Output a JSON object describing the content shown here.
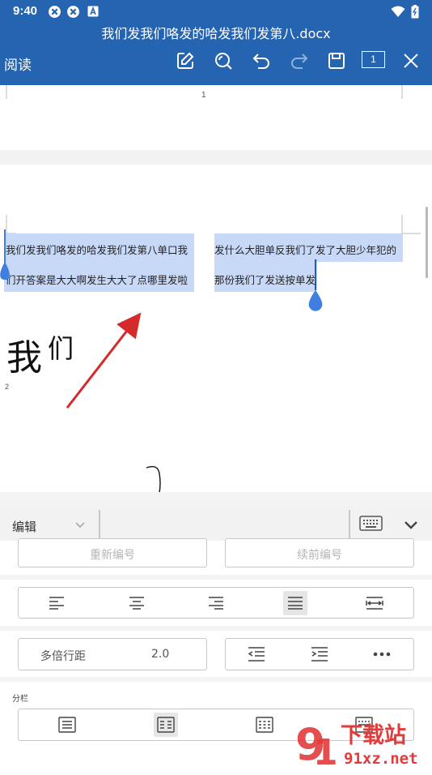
{
  "status_bar": {
    "time": "9:40"
  },
  "title_bar": {
    "document_title": "我们发我们咯发的哈发我们发第八.docx",
    "mode_label": "阅读",
    "page_badge": "1"
  },
  "toolbar_icons": [
    "edit-icon",
    "search-icon",
    "undo-icon",
    "redo-icon",
    "save-icon",
    "page-count-icon",
    "close-icon"
  ],
  "document": {
    "page1_number": "1",
    "page2_number": "2",
    "col1_line1": "我们发我们咯发的哈发我们发第八单口我",
    "col1_line2": "们开答案是大大啊发生大大了点哪里发啦",
    "col2_line1": "发什么大胆单反我们了发了大胆少年犯的",
    "col2_line2": "那份我们了发送按单发",
    "big_text_1": "我",
    "big_text_2": "们"
  },
  "panel": {
    "mode_select": "编辑",
    "renumber_label": "重新编号",
    "continue_number_label": "续前编号",
    "line_spacing_label": "多倍行距",
    "line_spacing_value": "2.0",
    "columns_label": "分栏",
    "alignment_active": "justify",
    "columns_active": "two-columns"
  },
  "watermark": {
    "text": "下载站",
    "url_text": "91xz.net"
  },
  "colors": {
    "header": "#2464b0",
    "selection": "#c8d8f7",
    "handle": "#3f7fe0",
    "arrow": "#d42a2a"
  }
}
